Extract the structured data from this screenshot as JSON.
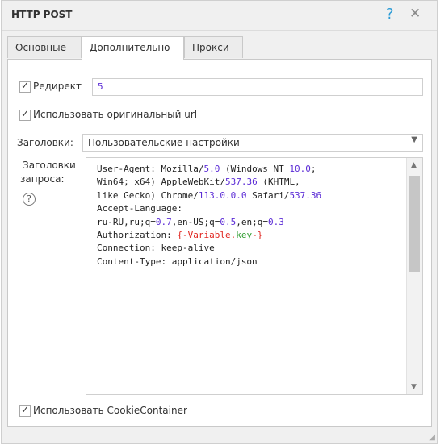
{
  "window": {
    "title": "HTTP POST",
    "help_glyph": "?",
    "close_glyph": "✕"
  },
  "tabs": [
    {
      "label": "Основные",
      "active": false
    },
    {
      "label": "Дополнительно",
      "active": true
    },
    {
      "label": "Прокси",
      "active": false
    }
  ],
  "redirect": {
    "label": "Редирект",
    "checked": true,
    "value": "5"
  },
  "original_url": {
    "label": "Использовать оригинальный url",
    "checked": true
  },
  "headers_mode": {
    "label": "Заголовки:",
    "selected": "Пользовательские настройки"
  },
  "request_headers": {
    "label_line1": "Заголовки",
    "label_line2": "запроса:",
    "help_glyph": "?",
    "line1": {
      "a": "User-Agent: Mozilla/",
      "n1": "5.0",
      "b": " (Windows NT ",
      "n2": "10.0",
      "c": ";"
    },
    "line2": {
      "a": "Win64; x64) AppleWebKit/",
      "n1": "537.36",
      "b": " (KHTML,"
    },
    "line3": {
      "a": "like Gecko) Chrome/",
      "n1": "113.0.0.0",
      "b": " Safari/",
      "n2": "537.36"
    },
    "line4": "Accept-Language:",
    "line5": {
      "a": "ru-RU,ru;q=",
      "n1": "0.7",
      "b": ",en-US;q=",
      "n2": "0.5",
      "c": ",en;q=",
      "n3": "0.3"
    },
    "line6": {
      "a": "Authorization: ",
      "v1": "{-Variable.",
      "k": "key",
      "v2": "-}"
    },
    "line7": "Connection: keep-alive",
    "line8": "Content-Type: application/json"
  },
  "cookie_container": {
    "label": "Использовать CookieContainer",
    "checked": true
  },
  "check_glyph": "✓"
}
